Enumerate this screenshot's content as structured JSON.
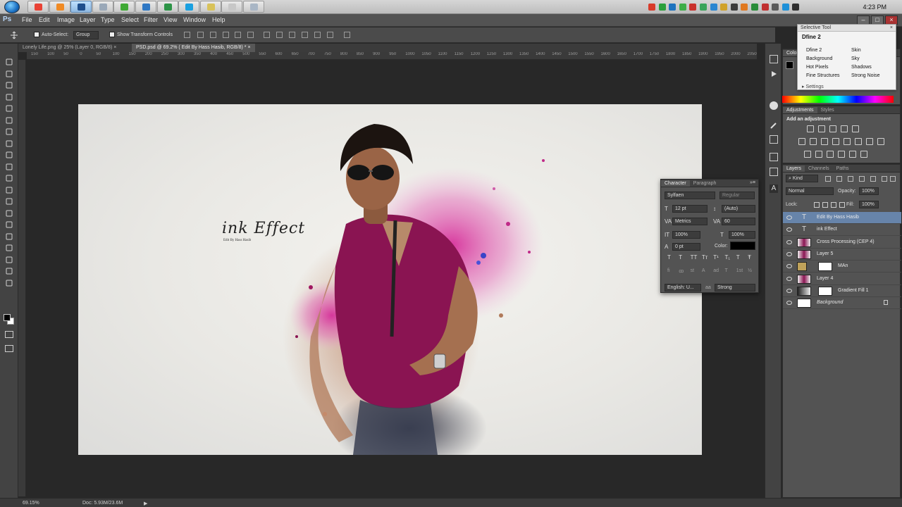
{
  "window": {
    "clock": "4:23 PM",
    "app_logo": "Ps"
  },
  "taskbar": {
    "apps": [
      {
        "icon": "chrome-icon",
        "color": "#e94235"
      },
      {
        "icon": "firefox-icon",
        "color": "#f08a24"
      },
      {
        "icon": "photoshop-icon",
        "color": "#1f4e8c",
        "active": true
      },
      {
        "icon": "app-icon",
        "color": "#9aa8b8"
      },
      {
        "icon": "media-player-icon",
        "color": "#3fa935"
      },
      {
        "icon": "ie-icon",
        "color": "#2f78c4"
      },
      {
        "icon": "wordpress-icon",
        "color": "#2d9447"
      },
      {
        "icon": "skype-icon",
        "color": "#1aa0e0"
      },
      {
        "icon": "folder-icon",
        "color": "#d8c25a"
      },
      {
        "icon": "app-icon-2",
        "color": "#c7c7c7"
      },
      {
        "icon": "app-icon-3",
        "color": "#a9b6c5"
      }
    ],
    "tray": [
      "#d83b2a",
      "#2aa03b",
      "#1e73be",
      "#3fae49",
      "#c9302c",
      "#39a45a",
      "#2a86d1",
      "#d0a22a",
      "#3c3c3c",
      "#e07820",
      "#2a8c3a",
      "#c03030",
      "#5a5a5a",
      "#1e90d8",
      "#2f2f2f"
    ]
  },
  "menu": {
    "items": [
      "File",
      "Edit",
      "Image",
      "Layer",
      "Type",
      "Select",
      "Filter",
      "View",
      "Window",
      "Help"
    ]
  },
  "options": {
    "auto_select": "Auto-Select:",
    "group": "Group",
    "show_transform": "Show Transform Controls"
  },
  "doc_tabs": [
    {
      "label": "Lonely Life.png @ 25% (Layer 0, RGB/8)",
      "active": false
    },
    {
      "label": "PSD.psd @ 69.2% ( Edit By Hass Hasib, RGB/8) *",
      "active": true
    }
  ],
  "ruler": {
    "h": [
      "150",
      "100",
      "50",
      "0",
      "50",
      "100",
      "150",
      "200",
      "250",
      "300",
      "350",
      "400",
      "450",
      "500",
      "550",
      "600",
      "650",
      "700",
      "750",
      "800",
      "850",
      "900",
      "950",
      "1000",
      "1050",
      "1100",
      "1150",
      "1200",
      "1250",
      "1300",
      "1350",
      "1400",
      "1450",
      "1500",
      "1550",
      "1600",
      "1650",
      "1700",
      "1750",
      "1800",
      "1850",
      "1900",
      "1950",
      "2000",
      "2050"
    ]
  },
  "artwork": {
    "title_script": "ink Effect",
    "subtitle": "Edit By Hass Hasib"
  },
  "selective_tool": {
    "header": "Selective Tool",
    "title": "Dfine 2",
    "rows": [
      [
        "Dfine 2",
        "Skin"
      ],
      [
        "Background",
        "Sky"
      ],
      [
        "Hot Pixels",
        "Shadows"
      ],
      [
        "Fine Structures",
        "Strong Noise"
      ]
    ],
    "settings": "Settings"
  },
  "color_panel": {
    "tab": "Color",
    "foreground": "#000000",
    "background": "#ffffff"
  },
  "adjustments": {
    "tabs": [
      "Adjustments",
      "Styles"
    ],
    "heading": "Add an adjustment"
  },
  "layers": {
    "tabs": [
      "Layers",
      "Channels",
      "Paths"
    ],
    "kind": "Kind",
    "blend": "Normal",
    "opacity_label": "Opacity:",
    "opacity": "100%",
    "lock_label": "Lock:",
    "fill_label": "Fill:",
    "fill": "100%",
    "rows": [
      {
        "name": "Edit By Hass Hasib",
        "type": "text",
        "selected": true
      },
      {
        "name": "ink Effect",
        "type": "text",
        "selected": false
      },
      {
        "name": "Cross Processing (CEP 4)",
        "type": "image",
        "selected": false
      },
      {
        "name": "Layer 5",
        "type": "image",
        "selected": false
      },
      {
        "name": "MAn",
        "type": "group",
        "selected": false
      },
      {
        "name": "Layer 4",
        "type": "image",
        "selected": false
      },
      {
        "name": "Gradient Fill 1",
        "type": "fill",
        "selected": false
      },
      {
        "name": "Background",
        "type": "background",
        "selected": false
      }
    ]
  },
  "character": {
    "tabs": [
      "Character",
      "Paragraph"
    ],
    "font": "Sylfaen",
    "style": "Regular",
    "size": "12 pt",
    "leading": "(Auto)",
    "kerning": "Metrics",
    "tracking": "60",
    "vscale": "100%",
    "hscale": "100%",
    "baseline": "0 pt",
    "color_label": "Color:",
    "text_color": "#000000",
    "language": "English: U...",
    "aa_label": "aa",
    "antialias": "Strong"
  },
  "status": {
    "zoom": "69.15%",
    "doc": "Doc: 5.93M/23.6M"
  }
}
